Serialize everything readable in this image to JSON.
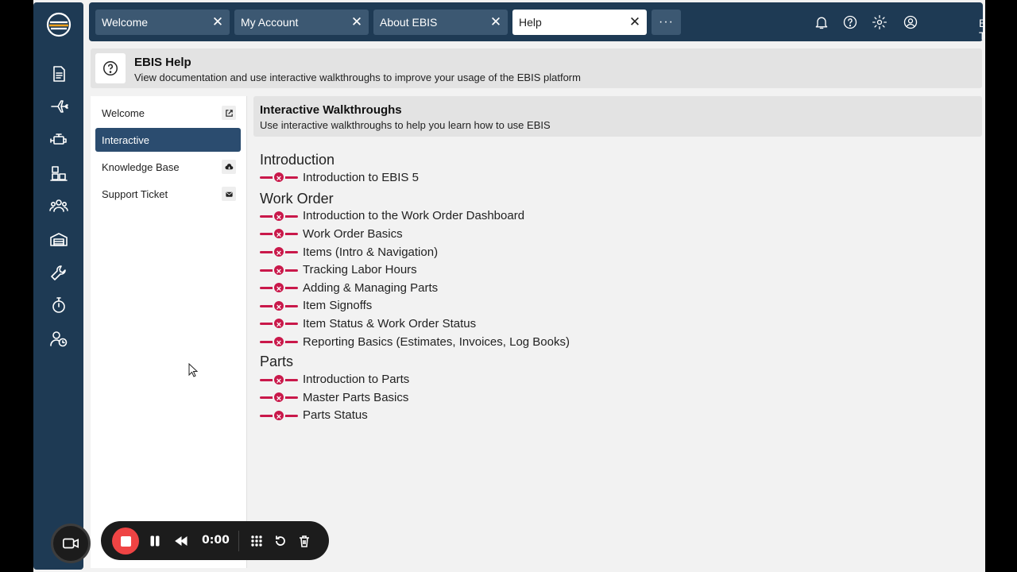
{
  "tabs": [
    {
      "label": "Welcome"
    },
    {
      "label": "My Account"
    },
    {
      "label": "About EBIS"
    },
    {
      "label": "Help"
    }
  ],
  "tab_more_label": "···",
  "tab_close_glyph": "✕",
  "user": {
    "name": "Billy Tech"
  },
  "help_header": {
    "title": "EBIS Help",
    "subtitle": "View documentation and use interactive walkthroughs to improve your usage of the EBIS platform"
  },
  "help_menu": [
    {
      "label": "Welcome",
      "icon": "external-link-icon"
    },
    {
      "label": "Interactive",
      "icon": null
    },
    {
      "label": "Knowledge Base",
      "icon": "cloud-download-icon"
    },
    {
      "label": "Support Ticket",
      "icon": "envelope-icon"
    }
  ],
  "walkthroughs": {
    "title": "Interactive Walkthroughs",
    "subtitle": "Use interactive walkthroughs to help you learn how to use EBIS",
    "status_glyph": "×",
    "sections": [
      {
        "title": "Introduction",
        "items": [
          "Introduction to EBIS 5"
        ]
      },
      {
        "title": "Work Order",
        "items": [
          "Introduction to the Work Order Dashboard",
          "Work Order Basics",
          "Items (Intro & Navigation)",
          "Tracking Labor Hours",
          "Adding & Managing Parts",
          "Item Signoffs",
          "Item Status & Work Order Status",
          "Reporting Basics (Estimates, Invoices, Log Books)"
        ]
      },
      {
        "title": "Parts",
        "items": [
          "Introduction to Parts",
          "Master Parts Basics",
          "Parts Status"
        ]
      }
    ]
  },
  "recorder": {
    "time": "0:00"
  },
  "colors": {
    "nav": "#1e3a54",
    "active": "#2b4c6f",
    "accent": "#c9184a",
    "record": "#ef4444"
  }
}
